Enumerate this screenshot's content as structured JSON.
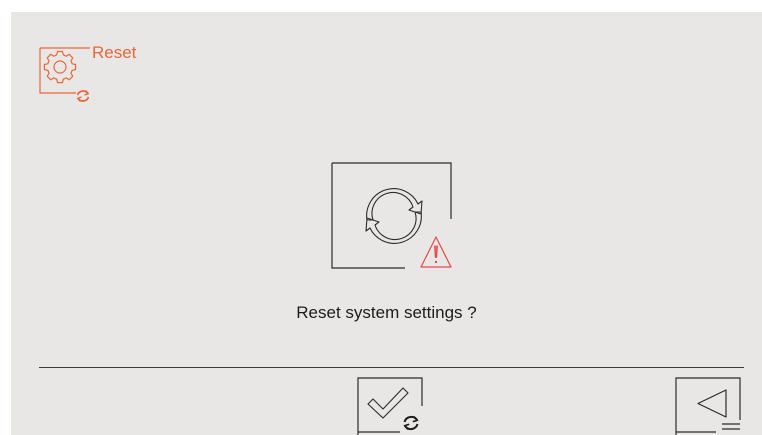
{
  "header": {
    "title": "Reset",
    "icon": "settings-reset-icon",
    "accent_color": "#e8673a"
  },
  "dialog": {
    "icon": "refresh-warning-icon",
    "warning_color": "#e14b4b",
    "prompt": "Reset system settings ?"
  },
  "footer": {
    "confirm_icon": "check-reset-icon",
    "back_icon": "back-arrow-icon"
  },
  "colors": {
    "background": "#e8e7e5",
    "text": "#1c1c1c",
    "line": "#3b3b3b"
  }
}
